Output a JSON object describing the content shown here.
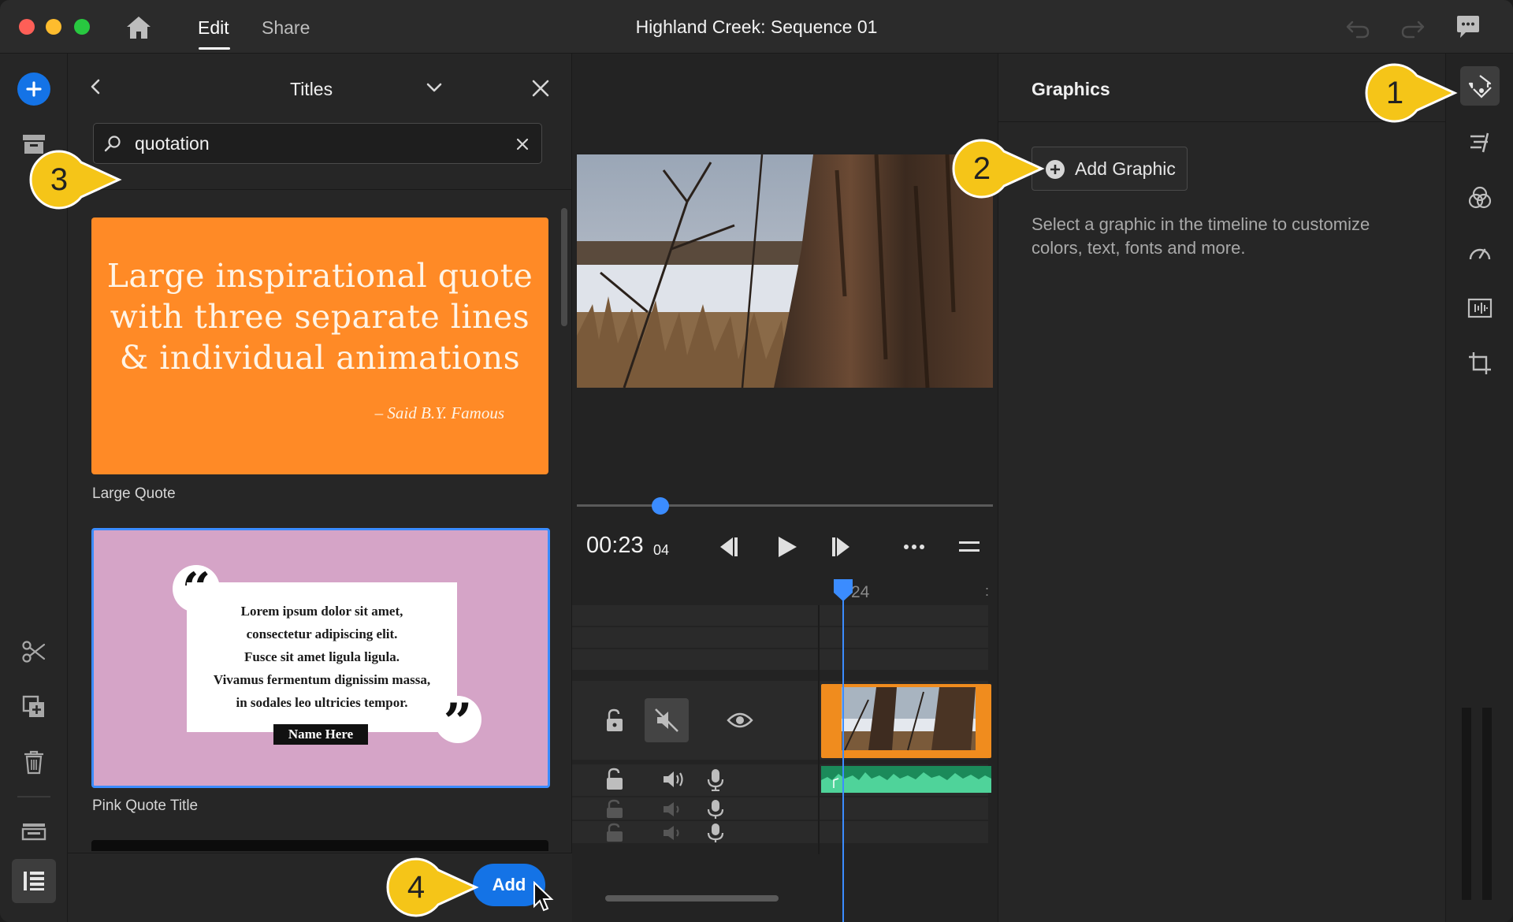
{
  "window": {
    "title": "Highland Creek: Sequence 01"
  },
  "header": {
    "tabs": [
      {
        "label": "Edit",
        "active": true
      },
      {
        "label": "Share",
        "active": false
      }
    ]
  },
  "titles_panel": {
    "title": "Titles",
    "search": {
      "value": "quotation"
    },
    "items": [
      {
        "name": "Large Quote",
        "preview_lines": [
          "Large inspirational quote",
          "with three separate lines",
          "& individual animations"
        ],
        "preview_attribution": "– Said B.Y. Famous",
        "color": "#ff8a26"
      },
      {
        "name": "Pink Quote Title",
        "preview_lines": [
          "Lorem ipsum dolor sit amet,",
          "consectetur adipiscing elit.",
          "Fusce sit amet ligula ligula.",
          "Vivamus fermentum dignissim massa,",
          "in sodales leo ultricies tempor."
        ],
        "preview_name": "Name Here",
        "color": "#d5a4c7",
        "selected": true
      }
    ],
    "add_button": "Add"
  },
  "player": {
    "timecode": "00:23",
    "timecode_frames": "04",
    "playhead_progress": 0.2
  },
  "timeline": {
    "ruler_label": "24",
    "ruler_suffix": ":"
  },
  "graphics_panel": {
    "title": "Graphics",
    "add_button": "Add Graphic",
    "help_text": "Select a graphic in the timeline to customize colors, text, fonts and more."
  },
  "callouts": [
    {
      "number": "1"
    },
    {
      "number": "2"
    },
    {
      "number": "3"
    },
    {
      "number": "4"
    }
  ],
  "colors": {
    "accent": "#1473e6",
    "callout": "#f5c518",
    "clip": "#f08c1e",
    "audio": "#1b8a5a"
  }
}
